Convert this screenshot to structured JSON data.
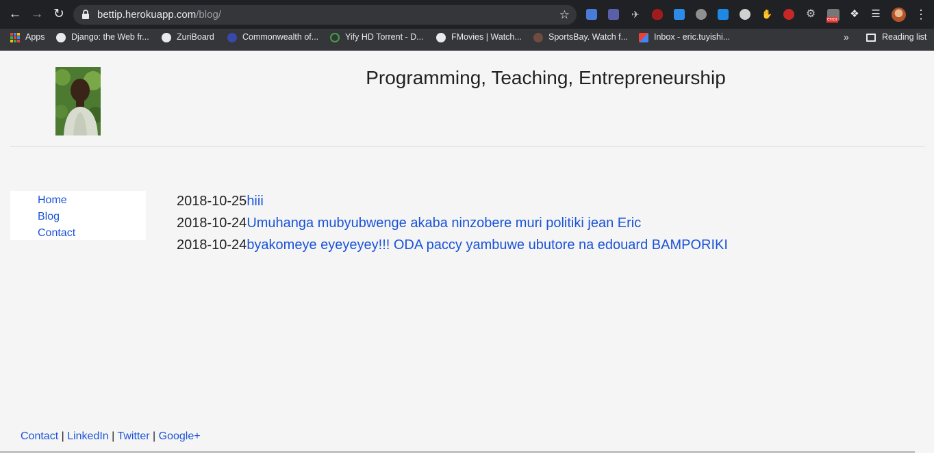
{
  "browser": {
    "url_host": "bettip.herokuapp.com",
    "url_path": "/blog/",
    "bookmarks": [
      {
        "label": "Apps",
        "icon": "apps-grid-icon"
      },
      {
        "label": "Django: the Web fr...",
        "icon": "globe-icon"
      },
      {
        "label": "ZuriBoard",
        "icon": "globe-icon"
      },
      {
        "label": "Commonwealth of...",
        "icon": "c-logo-icon"
      },
      {
        "label": "Yify HD Torrent - D...",
        "icon": "yify-icon"
      },
      {
        "label": "FMovies | Watch...",
        "icon": "globe-icon"
      },
      {
        "label": "SportsBay. Watch f...",
        "icon": "sportsbay-icon"
      },
      {
        "label": "Inbox - eric.tuyishi...",
        "icon": "gmail-icon"
      }
    ],
    "more_bookmarks": "»",
    "reading_list": "Reading list",
    "extension_badge": "error"
  },
  "site": {
    "title": "Programming, Teaching, Entrepreneurship",
    "nav": [
      "Home",
      "Blog",
      "Contact"
    ],
    "posts": [
      {
        "date": "2018-10-25",
        "title": "hiii"
      },
      {
        "date": "2018-10-24",
        "title": "Umuhanga mubyubwenge akaba ninzobere muri politiki jean Eric"
      },
      {
        "date": "2018-10-24",
        "title": "byakomeye eyeyeyey!!! ODA paccy yambuwe ubutore na edouard BAMPORIKI"
      }
    ],
    "footer": {
      "links": [
        "Contact",
        "LinkedIn",
        "Twitter",
        "Google+"
      ],
      "separator": "|"
    }
  }
}
